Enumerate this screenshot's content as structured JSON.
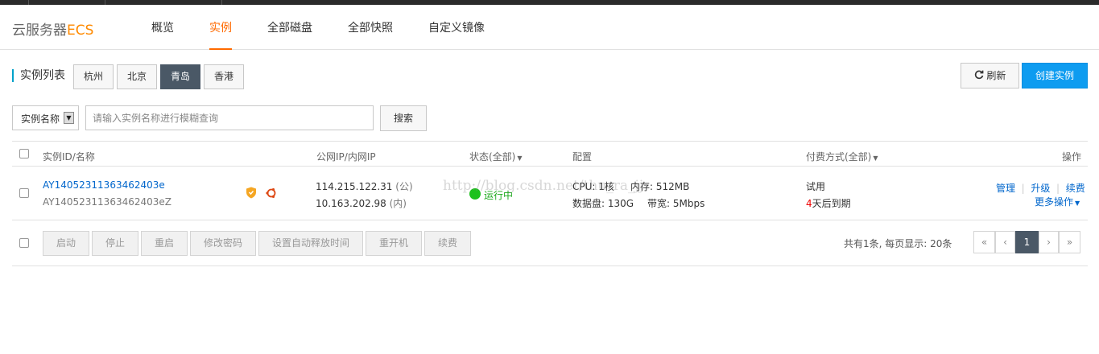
{
  "brand": {
    "name": "云服务器",
    "suffix": "ECS"
  },
  "nav": {
    "tabs": [
      {
        "label": "概览"
      },
      {
        "label": "实例",
        "active": true
      },
      {
        "label": "全部磁盘"
      },
      {
        "label": "全部快照"
      },
      {
        "label": "自定义镜像"
      }
    ]
  },
  "list": {
    "title": "实例列表",
    "regions": [
      {
        "label": "杭州"
      },
      {
        "label": "北京"
      },
      {
        "label": "青岛",
        "active": true
      },
      {
        "label": "香港"
      }
    ],
    "refresh_label": "刷新",
    "create_label": "创建实例"
  },
  "filter": {
    "select_value": "实例名称",
    "placeholder": "请输入实例名称进行模糊查询",
    "search_label": "搜索"
  },
  "table": {
    "headers": {
      "id_name": "实例ID/名称",
      "ip": "公网IP/内网IP",
      "status": "状态(全部)",
      "config": "配置",
      "billing": "付费方式(全部)",
      "actions": "操作"
    },
    "rows": [
      {
        "id": "AY14052311363462403e",
        "name": "AY14052311363462403eZ",
        "public_ip": "114.215.122.31",
        "public_tag": "(公)",
        "private_ip": "10.163.202.98",
        "private_tag": "(内)",
        "status": "运行中",
        "cpu": "CPU:  1核",
        "memory": "内存:  512MB",
        "disk": "数据盘:  130G",
        "bandwidth": "带宽:  5Mbps",
        "billing_type": "试用",
        "expire_days": "4",
        "expire_text": "天后到期",
        "actions": [
          "管理",
          "升级",
          "续费"
        ],
        "more_actions": "更多操作"
      }
    ]
  },
  "bulk_actions": [
    "启动",
    "停止",
    "重启",
    "修改密码",
    "设置自动释放时间",
    "重开机",
    "续费"
  ],
  "pagination": {
    "summary": "共有1条,  每页显示: 20条",
    "first": "«",
    "prev": "‹",
    "current": "1",
    "next": "›",
    "last": "»"
  },
  "watermark": "http://blog.csdn.net/thu_ra_jj",
  "colors": {
    "accent": "#ff6a00",
    "primary": "#0e9cf0",
    "running": "#1dc11d",
    "link": "#0066cc",
    "dark_active": "#4a5866"
  }
}
